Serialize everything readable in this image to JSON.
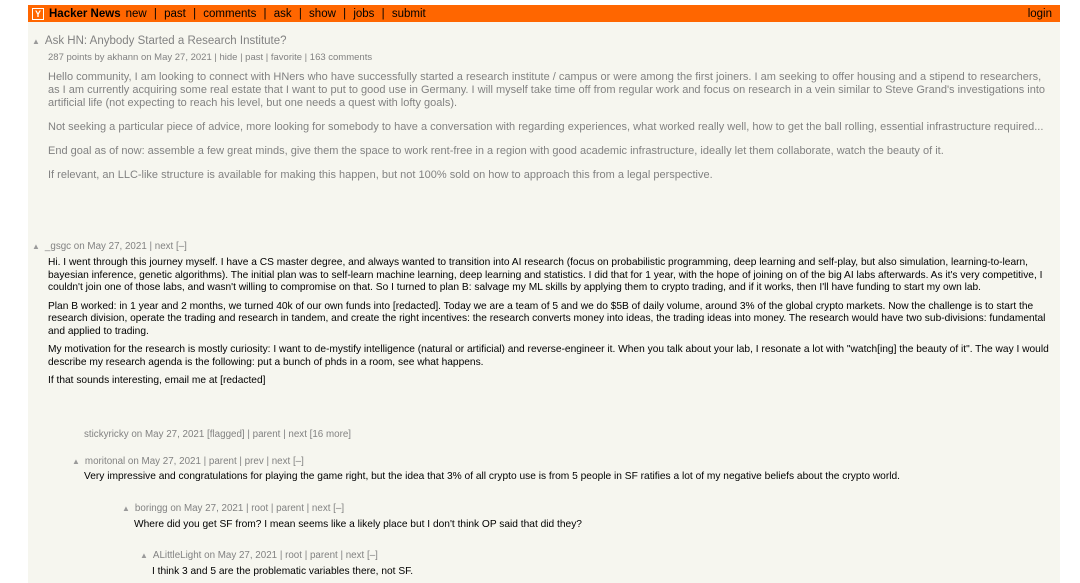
{
  "header": {
    "logo_letter": "Y",
    "brand": "Hacker News",
    "nav": [
      "new",
      "past",
      "comments",
      "ask",
      "show",
      "jobs",
      "submit"
    ],
    "nav_separator": "|",
    "login": "login",
    "bar_color": "#ff6600"
  },
  "story": {
    "title": "Ask HN: Anybody Started a Research Institute?",
    "subline": "287 points by akhann on May 27, 2021 | hide | past | favorite | 163 comments",
    "paragraphs": [
      "Hello community, I am looking to connect with HNers who have successfully started a research institute / campus or were among the first joiners. I am seeking to offer housing and a stipend to researchers, as I am currently acquiring some real estate that I want to put to good use in Germany. I will myself take time off from regular work and focus on research in a vein similar to Steve Grand's investigations into artificial life (not expecting to reach his level, but one needs a quest with lofty goals).",
      "Not seeking a particular piece of advice, more looking for somebody to have a conversation with regarding experiences, what worked really well, how to get the ball rolling, essential infrastructure required...",
      "End goal as of now: assemble a few great minds, give them the space to work rent-free in a region with good academic infrastructure, ideally let them collaborate, watch the beauty of it.",
      "If relevant, an LLC-like structure is available for making this happen, but not 100% sold on how to approach this from a legal perspective."
    ]
  },
  "comments": [
    {
      "head": "_gsgc on May 27, 2021 | next [–]",
      "paragraphs": [
        "Hi. I went through this journey myself. I have a CS master degree, and always wanted to transition into AI research (focus on probabilistic programming, deep learning and self-play, but also simulation, learning-to-learn, bayesian inference, genetic algorithms). The initial plan was to self-learn machine learning, deep learning and statistics. I did that for 1 year, with the hope of joining on of the big AI labs afterwards. As it's very competitive, I couldn't join one of those labs, and wasn't willing to compromise on that. So I turned to plan B: salvage my ML skills by applying them to crypto trading, and if it works, then I'll have funding to start my own lab.",
        "Plan B worked: in 1 year and 2 months, we turned 40k of our own funds into [redacted]. Today we are a team of 5 and we do $5B of daily volume, around 3% of the global crypto markets. Now the challenge is to start the research division, operate the trading and research in tandem, and create the right incentives: the research converts money into ideas, the trading ideas into money. The research would have two sub-divisions: fundamental and applied to trading.",
        "My motivation for the research is mostly curiosity: I want to de-mystify intelligence (natural or artificial) and reverse-engineer it. When you talk about your lab, I resonate a lot with \"watch[ing] the beauty of it\". The way I would describe my research agenda is the following: put a bunch of phds in a room, see what happens.",
        "If that sounds interesting, email me at [redacted]"
      ]
    },
    {
      "head": "stickyricky on May 27, 2021 [flagged] | parent | next [16 more]",
      "paragraphs": []
    },
    {
      "head": "moritonal on May 27, 2021 | parent | prev | next [–]",
      "paragraphs": [
        "Very impressive and congratulations for playing the game right, but the idea that 3% of all crypto use is from 5 people in SF ratifies a lot of my negative beliefs about the crypto world."
      ]
    },
    {
      "head": "boringg on May 27, 2021 | root | parent | next [–]",
      "paragraphs": [
        "Where did you get SF from? I mean seems like a likely place but I don't think OP said that did they?"
      ]
    },
    {
      "head": "ALittleLight on May 27, 2021 | root | parent | next [–]",
      "paragraphs": [
        "I think 3 and 5 are the problematic variables there, not SF."
      ]
    }
  ]
}
